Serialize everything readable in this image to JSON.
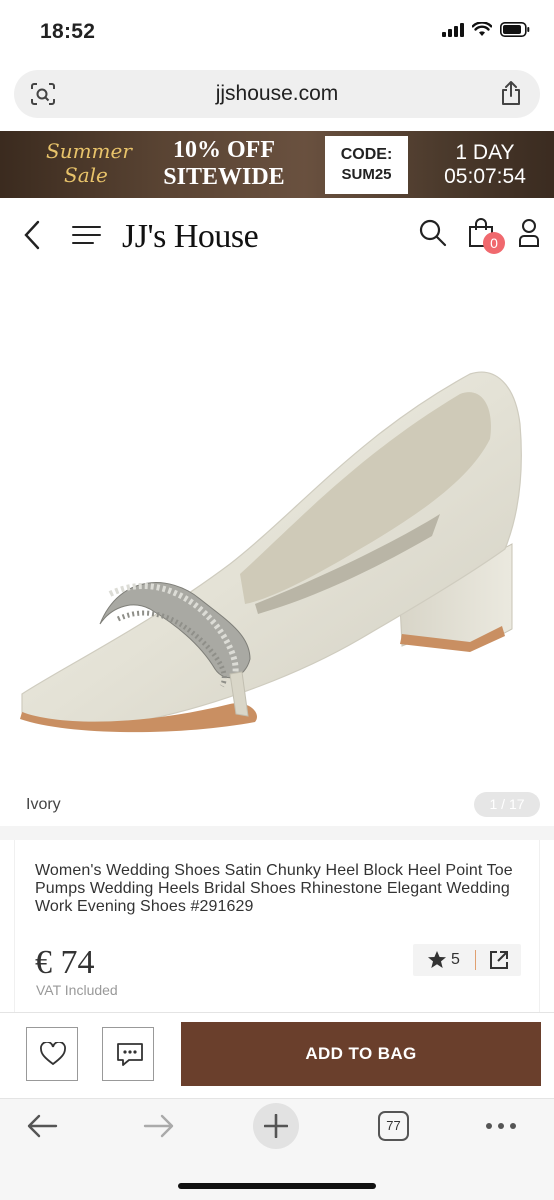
{
  "status_bar": {
    "time": "18:52"
  },
  "browser": {
    "url": "jjshouse.com",
    "tabs_count": "77"
  },
  "promo_banner": {
    "summer_line1": "Summer",
    "summer_line2": "Sale",
    "offer_line1": "10% OFF",
    "offer_line2": "SITEWIDE",
    "code_label": "CODE:",
    "code_value": "SUM25",
    "countdown_days": "1 DAY",
    "countdown_time": "05:07:54"
  },
  "header": {
    "logo": "JJ's House",
    "cart_count": "0"
  },
  "gallery": {
    "color_label": "Ivory",
    "image_counter": "1 / 17"
  },
  "product": {
    "title": "Women's Wedding Shoes Satin Chunky Heel Block Heel Point Toe Pumps Wedding Heels Bridal Shoes Rhinestone Elegant Wedding Work Evening Shoes #291629",
    "price": "€ 74",
    "vat": "VAT Included",
    "rating": "5"
  },
  "actions": {
    "add_to_bag": "ADD TO BAG"
  },
  "colors": {
    "brand_brown": "#6a3f2c",
    "badge_pink": "#f0696e",
    "banner_gold": "#e8c36a"
  }
}
